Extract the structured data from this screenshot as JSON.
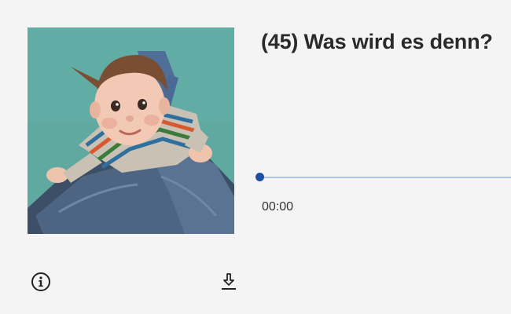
{
  "episode": {
    "title": "(45) Was wird es denn?",
    "cover_subject": "baby-crawling-on-legs-photo"
  },
  "player": {
    "current_time": "00:00",
    "progress_fraction": 0.0
  },
  "controls": {
    "info_icon": "info-icon",
    "download_icon": "download-icon"
  },
  "colors": {
    "accent": "#1d4fa3",
    "track": "#a9c4e4",
    "background": "#f4f4f4",
    "title_text": "#2a2a2a"
  }
}
